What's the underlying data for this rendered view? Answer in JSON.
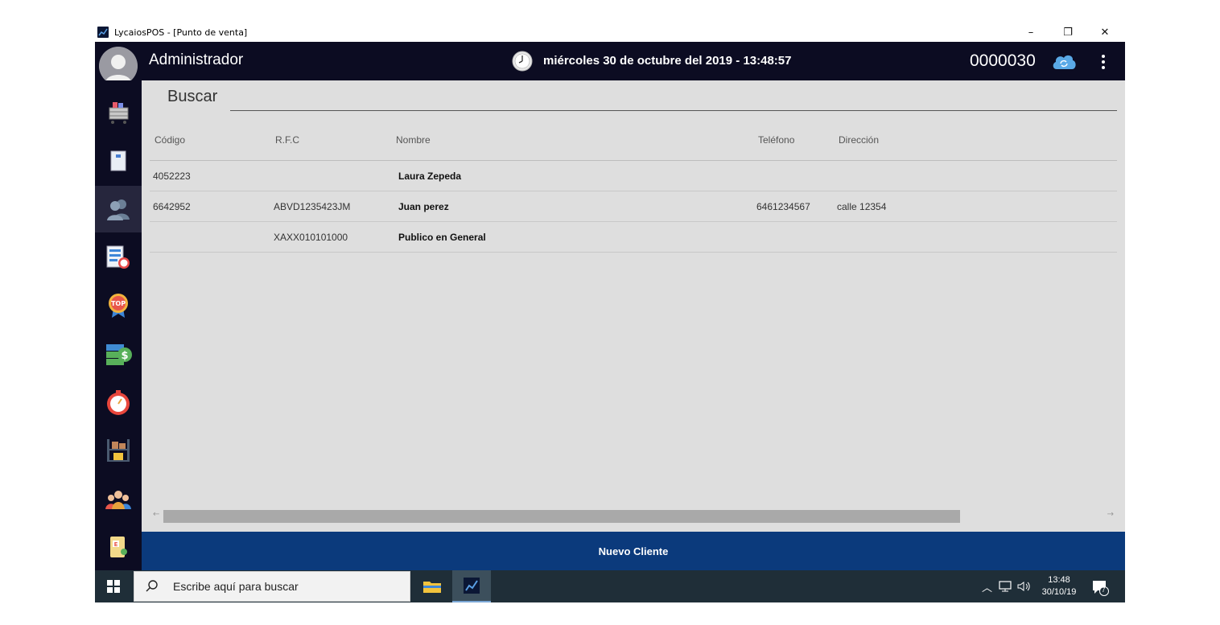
{
  "window": {
    "title": "LycaiosPOS - [Punto de venta]",
    "minimize": "–",
    "restore": "❐",
    "close": "✕"
  },
  "header": {
    "user": "Administrador",
    "datetime": "miércoles 30 de octubre del 2019 - 13:48:57",
    "ticket_number": "0000030"
  },
  "sidebar": {
    "items": [
      {
        "icon": "cart-icon"
      },
      {
        "icon": "notebook-icon"
      },
      {
        "icon": "customers-icon",
        "active": true
      },
      {
        "icon": "reports-clock-icon"
      },
      {
        "icon": "top-badge-icon"
      },
      {
        "icon": "money-icon"
      },
      {
        "icon": "stopwatch-icon"
      },
      {
        "icon": "inventory-shelf-icon"
      },
      {
        "icon": "users-group-icon"
      },
      {
        "icon": "document-icon"
      }
    ]
  },
  "search": {
    "label": "Buscar",
    "value": ""
  },
  "table": {
    "columns": [
      "Código",
      "R.F.C",
      "Nombre",
      "Teléfono",
      "Dirección"
    ],
    "rows": [
      {
        "codigo": "4052223",
        "rfc": "",
        "nombre": "Laura Zepeda",
        "telefono": "",
        "direccion": ""
      },
      {
        "codigo": "6642952",
        "rfc": "ABVD1235423JM",
        "nombre": "Juan perez",
        "telefono": "6461234567",
        "direccion": "calle 12354"
      },
      {
        "codigo": "",
        "rfc": "XAXX010101000",
        "nombre": "Publico en General",
        "telefono": "",
        "direccion": ""
      }
    ]
  },
  "actions": {
    "new_client": "Nuevo Cliente"
  },
  "taskbar": {
    "search_placeholder": "Escribe aquí para buscar",
    "time": "13:48",
    "date": "30/10/19",
    "notification_count": "7"
  },
  "colors": {
    "topbar": "#0c0c22",
    "content_bg": "#dedede",
    "primary_button": "#0b3a7c",
    "taskbar": "#1f2e38"
  }
}
